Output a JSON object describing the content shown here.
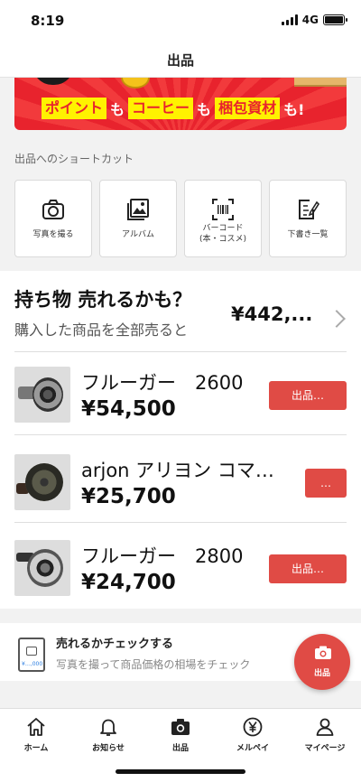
{
  "status_bar": {
    "time": "8:19",
    "network": "4G"
  },
  "nav": {
    "title": "出品"
  },
  "banner": {
    "chip1": "ポイント",
    "mo1": "も",
    "chip2": "コーヒー",
    "mo2": "も",
    "chip3": "梱包資材",
    "mo3": "も!"
  },
  "shortcuts": {
    "label": "出品へのショートカット",
    "items": [
      {
        "label": "写真を撮る",
        "icon": "camera-icon"
      },
      {
        "label": "アルバム",
        "icon": "album-icon"
      },
      {
        "label_line1": "バーコード",
        "label_line2": "(本・コスメ)",
        "icon": "barcode-icon"
      },
      {
        "label": "下書き一覧",
        "icon": "draft-icon"
      }
    ]
  },
  "sell": {
    "title": "持ち物 売れるかも？",
    "subtitle": "購入した商品を全部売ると",
    "total": "¥442,...",
    "items": [
      {
        "name": "フルーガー　2600",
        "price": "¥54,500",
        "button": "出品…"
      },
      {
        "name": "arjon アリヨン コマ…",
        "price": "¥25,700",
        "button": "…"
      },
      {
        "name": "フルーガー　2800",
        "price": "¥24,700",
        "button": "出品…"
      }
    ]
  },
  "check": {
    "title": "売れるかチェックする",
    "description": "写真を撮って商品価格の相場をチェック",
    "phone_price": "¥…,000"
  },
  "fab": {
    "label": "出品"
  },
  "tabs": [
    {
      "label": "ホーム",
      "icon": "home-icon"
    },
    {
      "label": "お知らせ",
      "icon": "bell-icon"
    },
    {
      "label": "出品",
      "icon": "camera-icon"
    },
    {
      "label": "メルペイ",
      "icon": "yen-icon"
    },
    {
      "label": "マイページ",
      "icon": "person-icon"
    }
  ],
  "colors": {
    "accent": "#e04b45",
    "banner_red": "#e8232d",
    "banner_yellow": "#fff200"
  }
}
